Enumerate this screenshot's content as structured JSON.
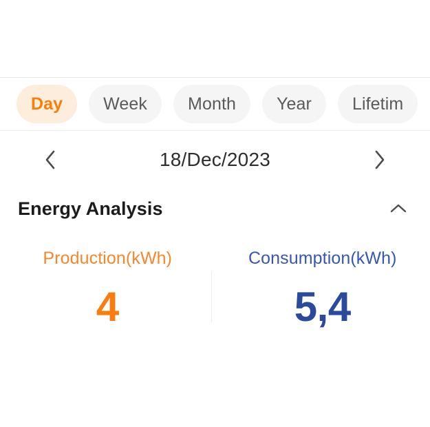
{
  "tabbar": {
    "tabs": [
      {
        "label": "Day",
        "active": true
      },
      {
        "label": "Week",
        "active": false
      },
      {
        "label": "Month",
        "active": false
      },
      {
        "label": "Year",
        "active": false
      },
      {
        "label": "Lifetim",
        "active": false
      }
    ],
    "indicator_color": "#fb7e05",
    "active_bg": "#fdeddd",
    "active_text_color": "#f97f0b",
    "inactive_bg": "#f5f5f5",
    "inactive_text_color": "#5a5a5a"
  },
  "datenav": {
    "prev_icon": "chevron-left-icon",
    "next_icon": "chevron-right-icon",
    "date": "18/Dec/2023"
  },
  "section": {
    "title": "Energy Analysis",
    "collapse_icon": "chevron-up-icon"
  },
  "metrics": [
    {
      "label": "Production(kWh)",
      "value": "4",
      "label_color": "#f9872a",
      "value_color": "#f97c0c"
    },
    {
      "label": "Consumption(kWh)",
      "value": "5,4",
      "label_color": "#3758b0",
      "value_color": "#2a4b9b"
    }
  ]
}
